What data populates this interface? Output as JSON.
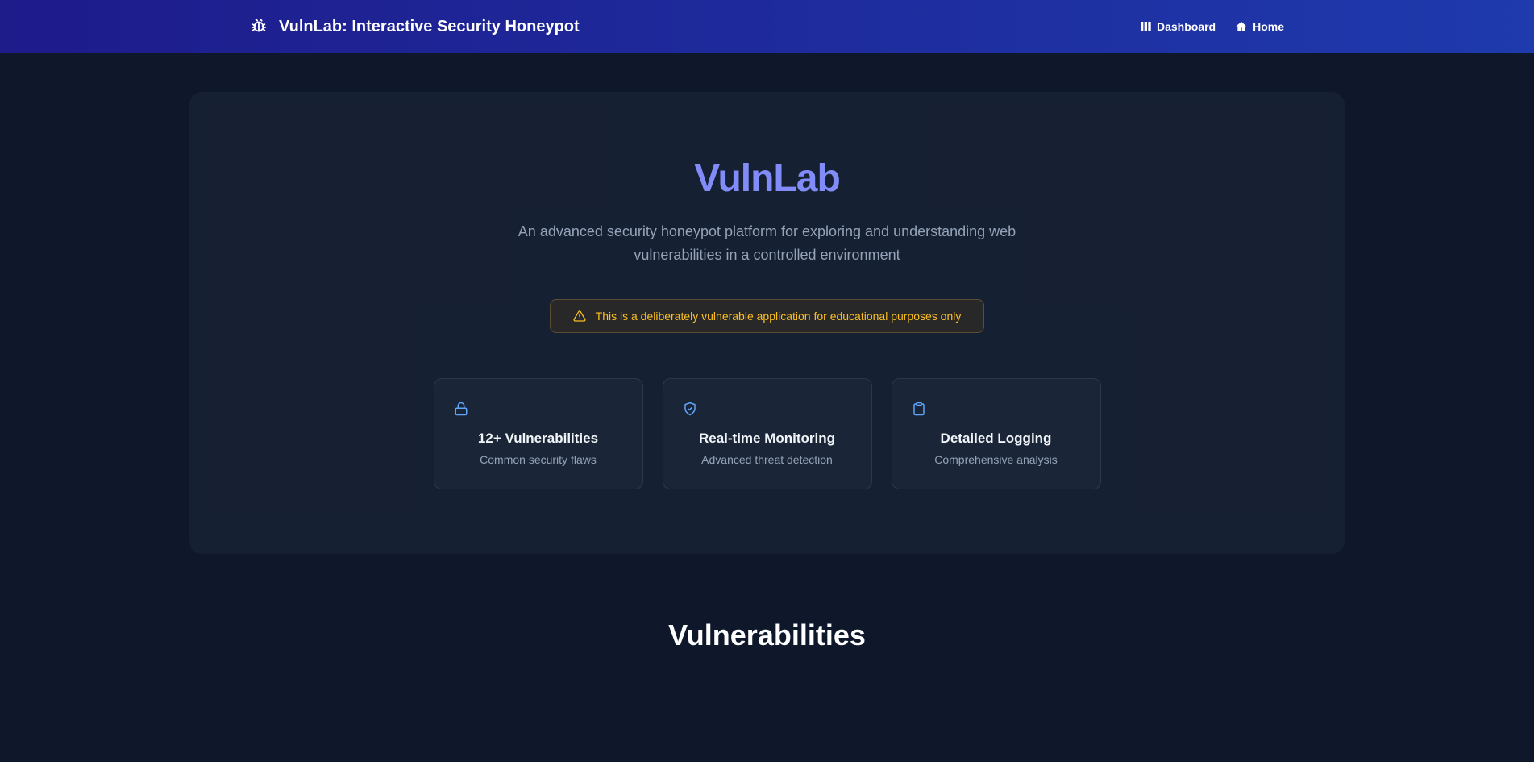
{
  "header": {
    "title": "VulnLab: Interactive Security Honeypot",
    "nav": {
      "dashboard": "Dashboard",
      "home": "Home"
    }
  },
  "hero": {
    "title": "VulnLab",
    "description": "An advanced security honeypot platform for exploring and understanding web vulnerabilities in a controlled environment",
    "warning": "This is a deliberately vulnerable application for educational purposes only"
  },
  "features": [
    {
      "title": "12+ Vulnerabilities",
      "subtitle": "Common security flaws",
      "icon": "lock"
    },
    {
      "title": "Real-time Monitoring",
      "subtitle": "Advanced threat detection",
      "icon": "shield"
    },
    {
      "title": "Detailed Logging",
      "subtitle": "Comprehensive analysis",
      "icon": "clipboard"
    }
  ],
  "sections": {
    "vulnerabilities": "Vulnerabilities"
  }
}
